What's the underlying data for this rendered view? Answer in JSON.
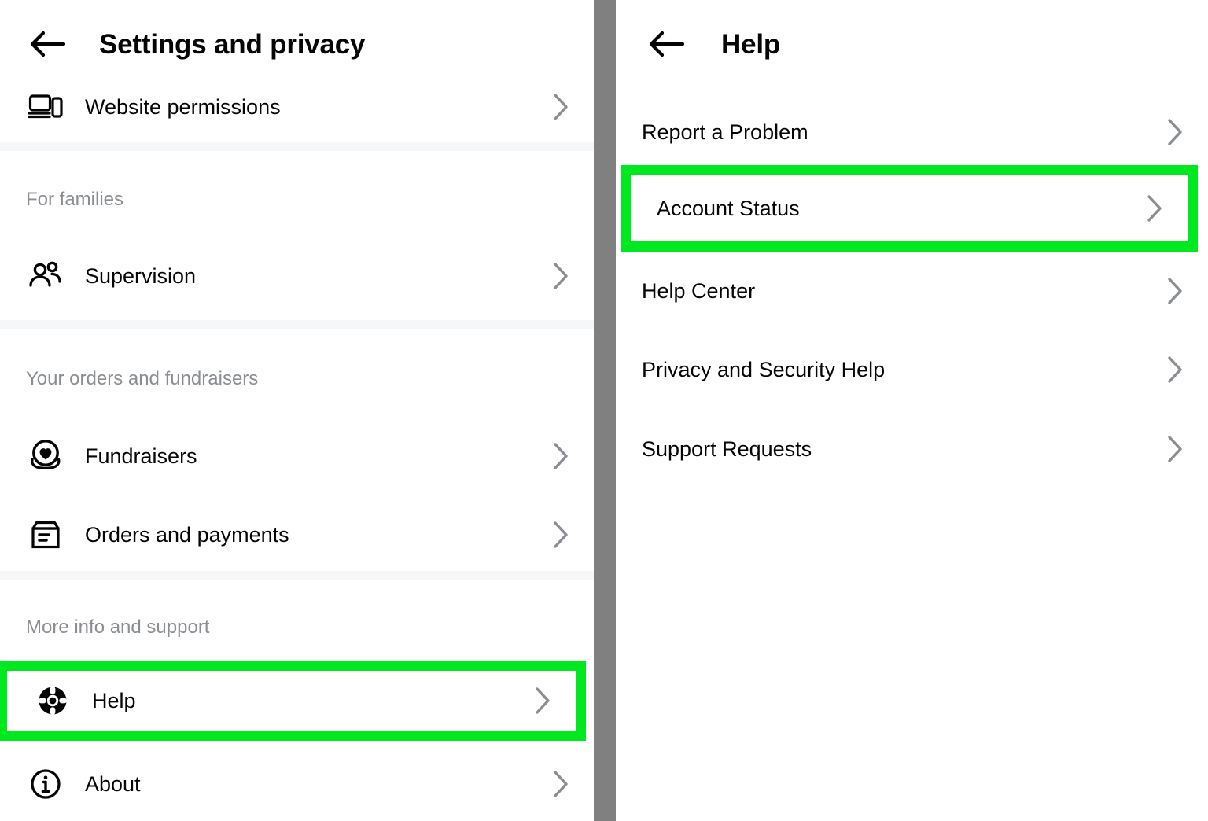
{
  "left_panel": {
    "header": {
      "back_icon": "back-arrow-icon",
      "title": "Settings and privacy"
    },
    "top_items": [
      {
        "label": "Website permissions",
        "icon": "devices-icon",
        "chevron": "chevron-right-icon"
      }
    ],
    "sections": [
      {
        "label": "For families",
        "items": [
          {
            "label": "Supervision",
            "icon": "people-icon",
            "chevron": "chevron-right-icon"
          }
        ]
      },
      {
        "label": "Your orders and fundraisers",
        "items": [
          {
            "label": "Fundraisers",
            "icon": "heart-circle-icon",
            "chevron": "chevron-right-icon"
          },
          {
            "label": "Orders and payments",
            "icon": "box-icon",
            "chevron": "chevron-right-icon"
          }
        ]
      },
      {
        "label": "More info and support",
        "items": [
          {
            "label": "Help",
            "icon": "lifebuoy-icon",
            "chevron": "chevron-right-icon",
            "highlighted": true
          },
          {
            "label": "About",
            "icon": "info-circle-icon",
            "chevron": "chevron-right-icon"
          }
        ]
      }
    ]
  },
  "right_panel": {
    "header": {
      "back_icon": "back-arrow-icon",
      "title": "Help"
    },
    "items": [
      {
        "label": "Report a Problem",
        "chevron": "chevron-right-icon"
      },
      {
        "label": "Account Status",
        "chevron": "chevron-right-icon",
        "highlighted": true
      },
      {
        "label": "Help Center",
        "chevron": "chevron-right-icon"
      },
      {
        "label": "Privacy and Security Help",
        "chevron": "chevron-right-icon"
      },
      {
        "label": "Support Requests",
        "chevron": "chevron-right-icon"
      }
    ]
  },
  "colors": {
    "highlight_green": "#00e81f",
    "gutter_gray": "#808080",
    "section_label_gray": "#8a8d91",
    "chevron_gray": "#8a8d91",
    "text_primary": "#050505",
    "divider_band": "#f6f7f8"
  }
}
